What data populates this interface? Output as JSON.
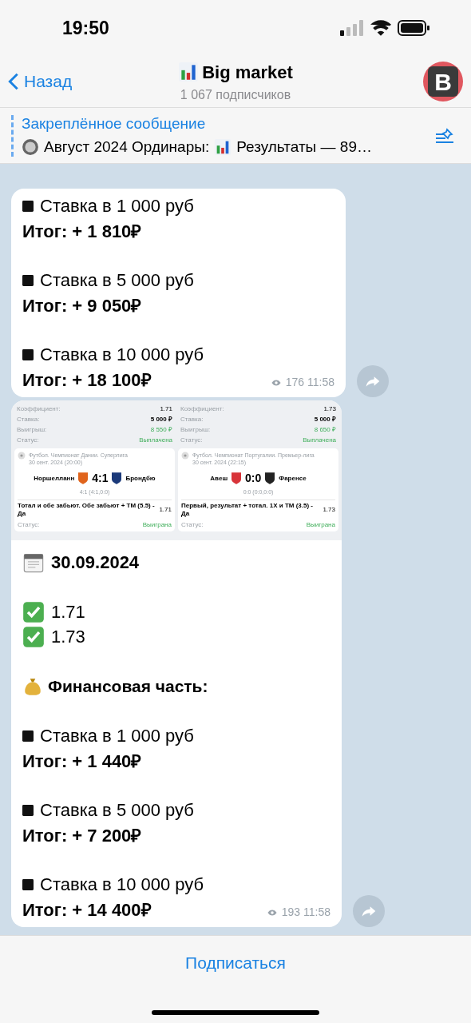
{
  "status_bar": {
    "time": "19:50"
  },
  "header": {
    "back": "Назад",
    "title": "Big market",
    "subtitle": "1 067 подписчиков",
    "avatar": "B"
  },
  "pinned": {
    "label": "Закреплённое сообщение",
    "text_before": "Август 2024 Ординары:",
    "text_after": "Результаты — 89…"
  },
  "messages": [
    {
      "lines": [
        {
          "kind": "stake",
          "text": "Ставка в 1 000 руб"
        },
        {
          "kind": "total",
          "text": "Итог: + 1 810₽"
        },
        {
          "kind": "blank"
        },
        {
          "kind": "stake",
          "text": "Ставка в 5 000 руб"
        },
        {
          "kind": "total",
          "text": "Итог: + 9 050₽"
        },
        {
          "kind": "blank"
        },
        {
          "kind": "stake",
          "text": "Ставка в 10 000 руб"
        },
        {
          "kind": "total",
          "text": "Итог: + 18 100₽"
        }
      ],
      "views": "176",
      "time": "11:58"
    },
    {
      "bets": [
        {
          "coef_label": "Коэффициент:",
          "coef": "1.71",
          "stake_label": "Ставка:",
          "stake": "5 000 ₽",
          "win_label": "Выигрыш:",
          "win": "8 550 ₽",
          "status_label": "Статус:",
          "status": "Выплачена",
          "league": "Футбол. Чемпионат Дании. Суперлига",
          "date": "30 сент. 2024 (20:00)",
          "team1": "Норшелланн",
          "score": "4:1",
          "team2": "Брондбю",
          "subscore": "4:1 (4:1,0:0)",
          "market": "Тотал и обе забьют. Обе забьют + ТМ (5.5) - Да",
          "odds": "1.71",
          "result_label": "Статус:",
          "result": "Выиграна"
        },
        {
          "coef_label": "Коэффициент:",
          "coef": "1.73",
          "stake_label": "Ставка:",
          "stake": "5 000 ₽",
          "win_label": "Выигрыш:",
          "win": "8 650 ₽",
          "status_label": "Статус:",
          "status": "Выплачена",
          "league": "Футбол. Чемпионат Португалии. Премьер-лига",
          "date": "30 сент. 2024 (22:15)",
          "team1": "Авеш",
          "score": "0:0",
          "team2": "Фаренсе",
          "subscore": "0:0 (0:0,0:0)",
          "market": "Первый, результат + тотал. 1Х и ТМ (3.5) - Да",
          "odds": "1.73",
          "result_label": "Статус:",
          "result": "Выиграна"
        }
      ],
      "lines": [
        {
          "kind": "date",
          "text": "30.09.2024"
        },
        {
          "kind": "blank"
        },
        {
          "kind": "check",
          "text": "1.71"
        },
        {
          "kind": "check",
          "text": "1.73"
        },
        {
          "kind": "blank"
        },
        {
          "kind": "heading",
          "text": "Финансовая часть:"
        },
        {
          "kind": "blank"
        },
        {
          "kind": "stake",
          "text": "Ставка в 1 000 руб"
        },
        {
          "kind": "total",
          "text": "Итог: + 1 440₽"
        },
        {
          "kind": "blank"
        },
        {
          "kind": "stake",
          "text": "Ставка в 5 000 руб"
        },
        {
          "kind": "total",
          "text": "Итог: + 7 200₽"
        },
        {
          "kind": "blank"
        },
        {
          "kind": "stake",
          "text": "Ставка в 10 000 руб"
        },
        {
          "kind": "total",
          "text": "Итог: + 14 400₽"
        }
      ],
      "views": "193",
      "time": "11:58"
    }
  ],
  "footer": {
    "button": "Подписаться"
  }
}
